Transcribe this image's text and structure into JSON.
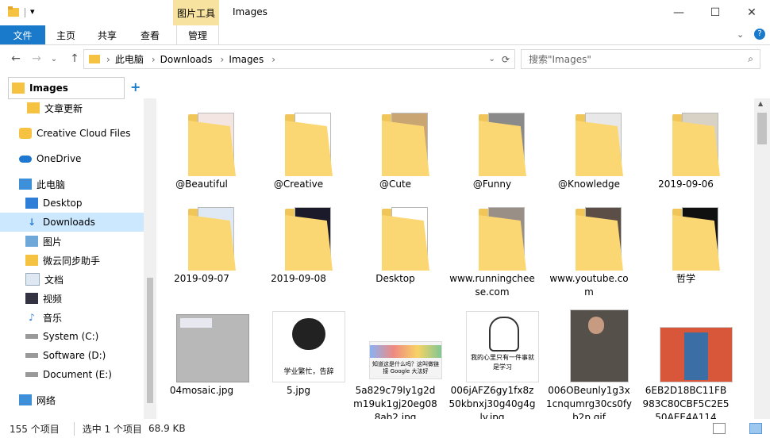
{
  "titlebar": {
    "context_tab": "图片工具",
    "title": "Images",
    "min": "—",
    "max": "☐",
    "close": "✕"
  },
  "ribbon": {
    "file": "文件",
    "home": "主页",
    "share": "共享",
    "view": "查看",
    "manage": "管理"
  },
  "address": {
    "path": [
      "此电脑",
      "Downloads",
      "Images"
    ],
    "sep": "›"
  },
  "search": {
    "placeholder": "搜索\"Images\""
  },
  "sidebar": {
    "header": "Images",
    "add": "+",
    "items": [
      {
        "label": "文章更新",
        "icon": "folder-icon"
      },
      {
        "label": "Creative Cloud Files",
        "icon": "creative-cloud-icon"
      },
      {
        "label": "OneDrive",
        "icon": "cloud-icon"
      },
      {
        "label": "此电脑",
        "icon": "computer-icon"
      },
      {
        "label": "Desktop",
        "icon": "desktop-icon"
      },
      {
        "label": "Downloads",
        "icon": "download-icon"
      },
      {
        "label": "图片",
        "icon": "pictures-icon"
      },
      {
        "label": "微云同步助手",
        "icon": "folder-icon"
      },
      {
        "label": "文档",
        "icon": "documents-icon"
      },
      {
        "label": "视频",
        "icon": "video-icon"
      },
      {
        "label": "音乐",
        "icon": "music-icon"
      },
      {
        "label": "System (C:)",
        "icon": "drive-icon"
      },
      {
        "label": "Software (D:)",
        "icon": "drive-icon"
      },
      {
        "label": "Document (E:)",
        "icon": "drive-icon"
      },
      {
        "label": "网络",
        "icon": "network-icon"
      }
    ]
  },
  "files": [
    {
      "name": "@Beautiful",
      "kind": "folder"
    },
    {
      "name": "@Creative",
      "kind": "folder"
    },
    {
      "name": "@Cute",
      "kind": "folder"
    },
    {
      "name": "@Funny",
      "kind": "folder"
    },
    {
      "name": "@Knowledge",
      "kind": "folder"
    },
    {
      "name": "2019-09-06",
      "kind": "folder"
    },
    {
      "name": "2019-09-07",
      "kind": "folder"
    },
    {
      "name": "2019-09-08",
      "kind": "folder"
    },
    {
      "name": "Desktop",
      "kind": "folder"
    },
    {
      "name": "www.runningcheese.com",
      "kind": "folder"
    },
    {
      "name": "www.youtube.com",
      "kind": "folder"
    },
    {
      "name": "哲学",
      "kind": "folder"
    },
    {
      "name": "04mosaic.jpg",
      "kind": "image",
      "caption": ""
    },
    {
      "name": "5.jpg",
      "kind": "image",
      "caption": "学业繁忙，告辞"
    },
    {
      "name": "5a829c79ly1g2dm19uk1gj20eg088ab2.jpg",
      "kind": "image",
      "caption": "知道这是什么吗？这叫做链接 Google 大法好"
    },
    {
      "name": "006jAFZ6gy1fx8z50kbnxj30g40g4gly.jpg",
      "kind": "image",
      "caption": "我的心里只有一件事就是学习"
    },
    {
      "name": "006OBeunly1g3x1cnqumrg30cs0fyb2p.gif",
      "kind": "image",
      "caption": ""
    },
    {
      "name": "6EB2D18BC11FB983C80CBF5C2E550AEE4A114",
      "kind": "image",
      "caption": ""
    }
  ],
  "status": {
    "count": "155 个项目",
    "selected": "选中 1 个项目",
    "size": "68.9 KB"
  }
}
